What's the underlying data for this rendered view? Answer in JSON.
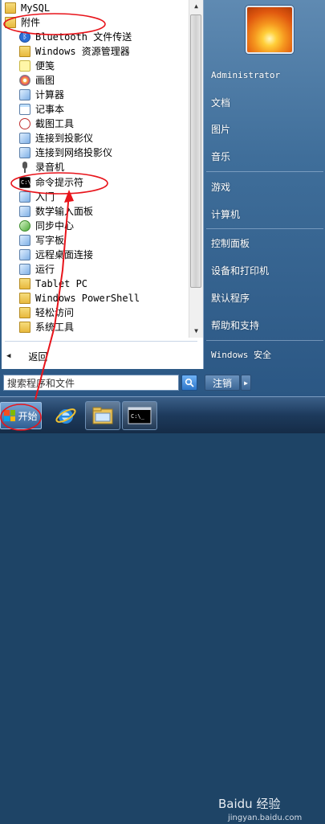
{
  "programs": [
    {
      "label": "MySQL",
      "icon": "folder-icon"
    },
    {
      "label": "附件",
      "icon": "folder-icon"
    },
    {
      "label": "Bluetooth 文件传送",
      "icon": "bluetooth-icon"
    },
    {
      "label": "Windows 资源管理器",
      "icon": "explorer-icon"
    },
    {
      "label": "便笺",
      "icon": "sticky-notes-icon"
    },
    {
      "label": "画图",
      "icon": "paint-icon"
    },
    {
      "label": "计算器",
      "icon": "calculator-icon"
    },
    {
      "label": "记事本",
      "icon": "notepad-icon"
    },
    {
      "label": "截图工具",
      "icon": "snipping-tool-icon"
    },
    {
      "label": "连接到投影仪",
      "icon": "projector-icon"
    },
    {
      "label": "连接到网络投影仪",
      "icon": "network-projector-icon"
    },
    {
      "label": "录音机",
      "icon": "microphone-icon"
    },
    {
      "label": "命令提示符",
      "icon": "cmd-icon"
    },
    {
      "label": "入门",
      "icon": "getting-started-icon"
    },
    {
      "label": "数学输入面板",
      "icon": "math-input-icon"
    },
    {
      "label": "同步中心",
      "icon": "sync-center-icon"
    },
    {
      "label": "写字板",
      "icon": "wordpad-icon"
    },
    {
      "label": "远程桌面连接",
      "icon": "remote-desktop-icon"
    },
    {
      "label": "运行",
      "icon": "run-icon"
    },
    {
      "label": "Tablet PC",
      "icon": "folder-icon"
    },
    {
      "label": "Windows PowerShell",
      "icon": "folder-icon"
    },
    {
      "label": "轻松访问",
      "icon": "folder-icon"
    },
    {
      "label": "系统工具",
      "icon": "folder-icon"
    }
  ],
  "back_label": "返回",
  "search": {
    "placeholder": "搜索程序和文件"
  },
  "right_items": [
    "Administrator",
    "文档",
    "图片",
    "音乐",
    "游戏",
    "计算机",
    "控制面板",
    "设备和打印机",
    "默认程序",
    "帮助和支持",
    "Windows 安全"
  ],
  "logout_label": "注销",
  "taskbar": {
    "start_label": "开始"
  },
  "watermark": {
    "brand": "Baidu 经验",
    "url": "jingyan.baidu.com"
  },
  "colors": {
    "annotation": "#e8141b",
    "menu_blue": "#3f6e9a"
  }
}
